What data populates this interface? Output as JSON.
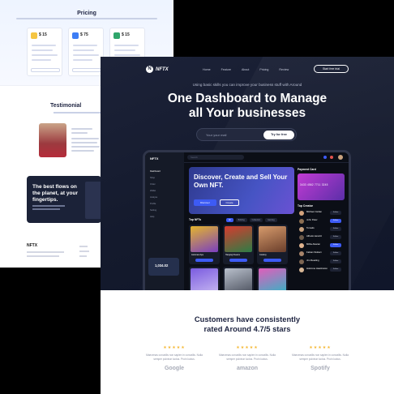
{
  "back_page": {
    "pricing_title": "Pricing",
    "plans": [
      {
        "price": "$ 15",
        "color": "#f5c542"
      },
      {
        "price": "$ 75",
        "color": "#3d7df5"
      },
      {
        "price": "$ 15",
        "color": "#2fa56b"
      }
    ],
    "testimonial_title": "Testimonial",
    "cta_text": "The best flows on the planet, at your fingertips.",
    "footer_logo": "NFTX"
  },
  "nav": {
    "logo": "NFTX",
    "links": [
      "Home",
      "Feature",
      "About",
      "Pricing",
      "Review"
    ],
    "cta": "Start free trial"
  },
  "hero": {
    "tagline": "Using basic skills you can improve your business stuff with Around",
    "headline_line1": "One Dashboard to Manage",
    "headline_line2": "all Your businesses",
    "email_placeholder": "Your your mail",
    "email_button": "Try for free"
  },
  "dashboard": {
    "logo": "NFTX",
    "search_placeholder": "Search",
    "sidebar": [
      "Dashboard",
      "Shop",
      "Order",
      "Wallet",
      "Analyse",
      "Profile",
      "Setting",
      "Help"
    ],
    "balance": "1,034.02",
    "banner_title": "Discover, Create and Sell Your Own NFT.",
    "banner_primary": "Discover",
    "banner_secondary": "Create",
    "payment_title": "Payment Card",
    "card_number": "3433 4562 7711 3245",
    "top_nfts_title": "Top NFTs",
    "filters": [
      "All",
      "Bidding",
      "Collection",
      "Gaming"
    ],
    "nfts": [
      {
        "name": "Astronaut Ape",
        "color1": "#e5b52d",
        "color2": "#7a3fc0"
      },
      {
        "name": "Hanging Dreams",
        "color1": "#d63b2f",
        "color2": "#2c7d45"
      },
      {
        "name": "Cowboy",
        "color1": "#d79b6c",
        "color2": "#6a3e2b"
      },
      {
        "name": "Owl Robot",
        "color1": "#7b5ce0",
        "color2": "#c8b9f2"
      },
      {
        "name": "Bear",
        "color1": "#b9c0cc",
        "color2": "#4a4f5c"
      },
      {
        "name": "Raccoon",
        "color1": "#e25dbb",
        "color2": "#2fb7c5"
      }
    ],
    "top_creator_title": "Top Creator",
    "creators": [
      {
        "name": "Michael Jordan",
        "follow": "Follow"
      },
      {
        "name": "John Peter",
        "follow": "Follow"
      },
      {
        "name": "Tomatis",
        "follow": "Follow"
      },
      {
        "name": "Alfredo Herwitz",
        "follow": "Follow"
      },
      {
        "name": "Mitha Alsaran",
        "follow": "Follow"
      },
      {
        "name": "Fabian Stoltern",
        "follow": "Follow"
      },
      {
        "name": "Jim Reading",
        "follow": "Follow"
      },
      {
        "name": "Holcrone Hawtinston",
        "follow": "Follow"
      }
    ]
  },
  "reviews": {
    "title_line1": "Customers have consistently",
    "title_line2": "rated Around 4.7/5 stars",
    "items": [
      {
        "stars": "★★★★★",
        "body": "Maecenas convallis non sapien in convallis. Nulla semper pulvinar luctus. Proin luctus.",
        "brand": "Google"
      },
      {
        "stars": "★★★★★",
        "body": "Maecenas convallis non sapien in convallis. Nulla semper pulvinar luctus. Proin luctus.",
        "brand": "amazon"
      },
      {
        "stars": "★★★★★",
        "body": "Maecenas convallis non sapien in convallis. Nulla semper pulvinar luctus. Proin luctus.",
        "brand": "Spotify"
      }
    ]
  }
}
